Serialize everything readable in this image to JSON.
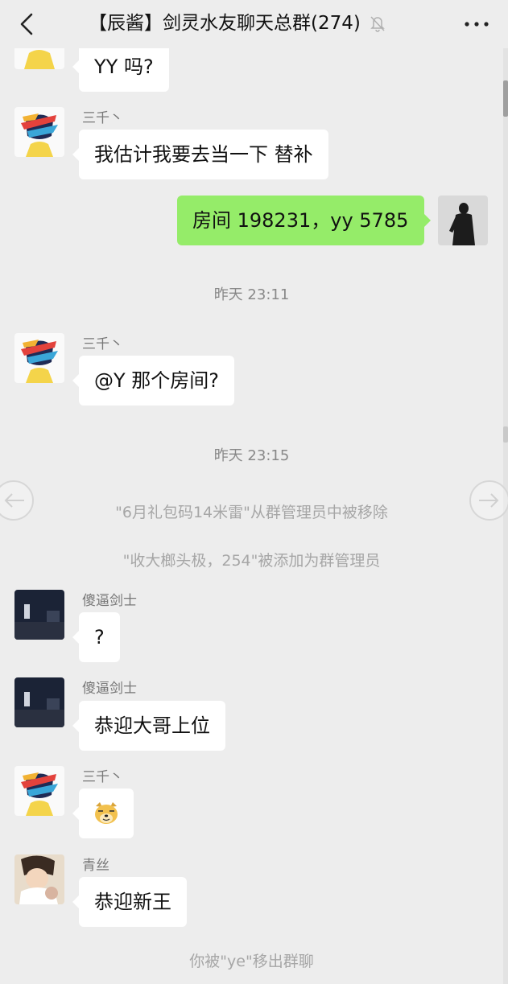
{
  "header": {
    "title": "【辰酱】剑灵水友聊天总群(274)",
    "back_icon": "chevron-left-icon",
    "mute_icon": "bell-off-icon",
    "more_icon": "more-dots-icon"
  },
  "messages": {
    "m0": {
      "text": "YY 吗?"
    },
    "m1": {
      "sender": "三千丶",
      "text": "我估计我要去当一下 替补"
    },
    "m2": {
      "text": "房间 198231，yy 5785"
    },
    "m3": {
      "sender": "三千丶",
      "text": "@Y  那个房间?"
    },
    "m4": {
      "sender": "傻逼剑士",
      "text": "?"
    },
    "m5": {
      "sender": "傻逼剑士",
      "text": "恭迎大哥上位"
    },
    "m6": {
      "sender": "三千丶",
      "emoji": "doge-emoji"
    },
    "m7": {
      "sender": "青丝",
      "text": "恭迎新王"
    }
  },
  "timestamps": {
    "t1": "昨天 23:11",
    "t2": "昨天 23:15"
  },
  "system": {
    "s1": "\"6月礼包码14米雷\"从群管理员中被移除",
    "s2": "\"收大榔头极，254\"被添加为群管理员",
    "s3": "你被\"ye\"移出群聊"
  },
  "colors": {
    "background": "#ededed",
    "my_bubble": "#95ec69",
    "other_bubble": "#ffffff"
  }
}
